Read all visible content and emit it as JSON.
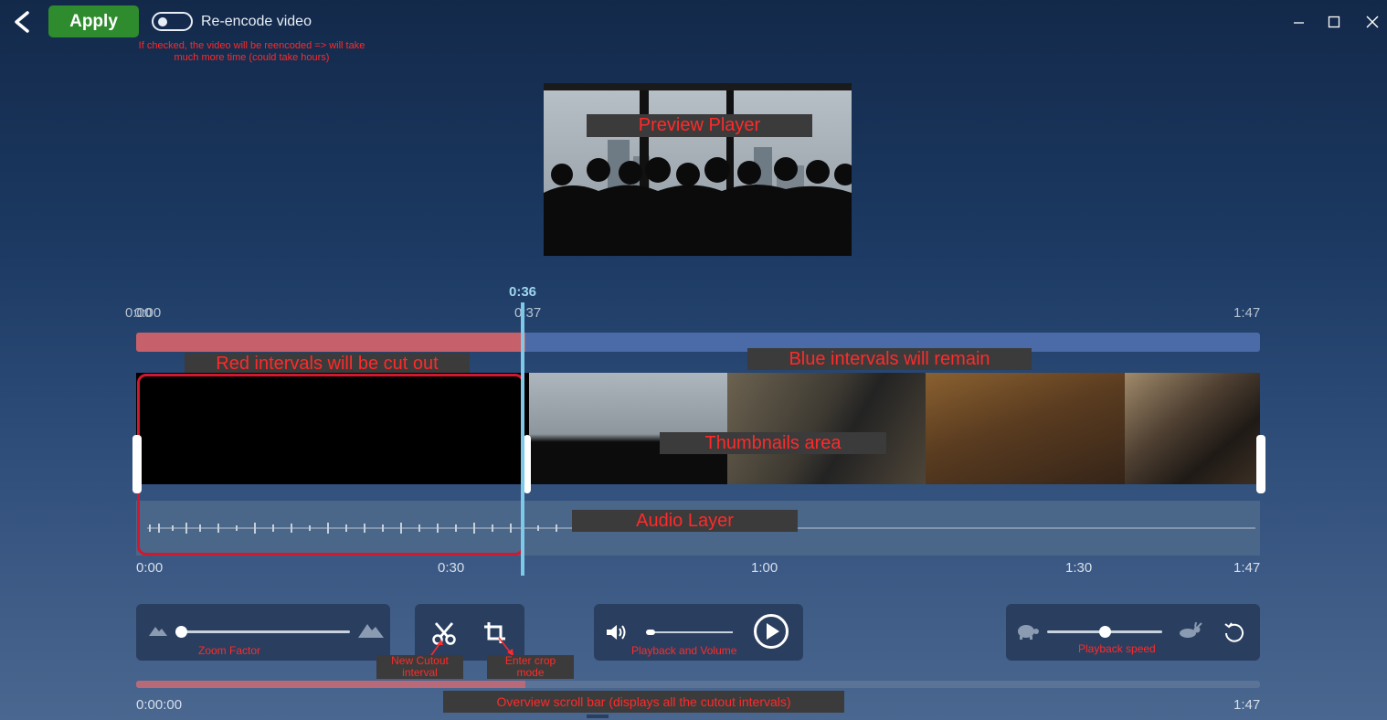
{
  "header": {
    "apply_label": "Apply",
    "reencode_label": "Re-encode video",
    "reencode_checked": false,
    "reencode_hint_line1": "If checked, the video will be reencoded => will take",
    "reencode_hint_line2": "much more time (could take hours)"
  },
  "window_controls": {
    "minimize": "minimize-icon",
    "maximize": "maximize-icon",
    "close": "close-icon"
  },
  "preview": {
    "annotation": "Preview Player"
  },
  "timeline": {
    "playhead_time": "0:36",
    "range_start_a": "0:00",
    "range_start_b": "0:00",
    "range_mid": "0:37",
    "range_end": "1:47",
    "annotation_red": "Red intervals will be cut out",
    "annotation_blue": "Blue intervals will remain",
    "annotation_thumbnails": "Thumbnails area",
    "annotation_audio": "Audio Layer",
    "ruler_ticks": [
      "0:00",
      "0:30",
      "1:00",
      "1:30",
      "1:47"
    ]
  },
  "controls": {
    "zoom_label": "Zoom Factor",
    "zoom_value": 0.0,
    "new_cutout_label_line1": "New Cutout",
    "new_cutout_label_line2": "interval",
    "crop_label_line1": "Enter crop",
    "crop_label_line2": "mode",
    "playback_volume_label": "Playback and Volume",
    "volume_value": 0.0,
    "speed_label": "Playback speed",
    "speed_value": 0.5
  },
  "overview": {
    "annotation": "Overview scroll bar (displays all the cutout intervals)",
    "start_time": "0:00:00",
    "end_time": "1:47"
  },
  "colors": {
    "apply_green": "#2e8b2e",
    "cut_red": "#c6606a",
    "keep_blue": "#4a6aa8",
    "playhead": "#7ec8e8",
    "cut_border": "#d0182f"
  }
}
